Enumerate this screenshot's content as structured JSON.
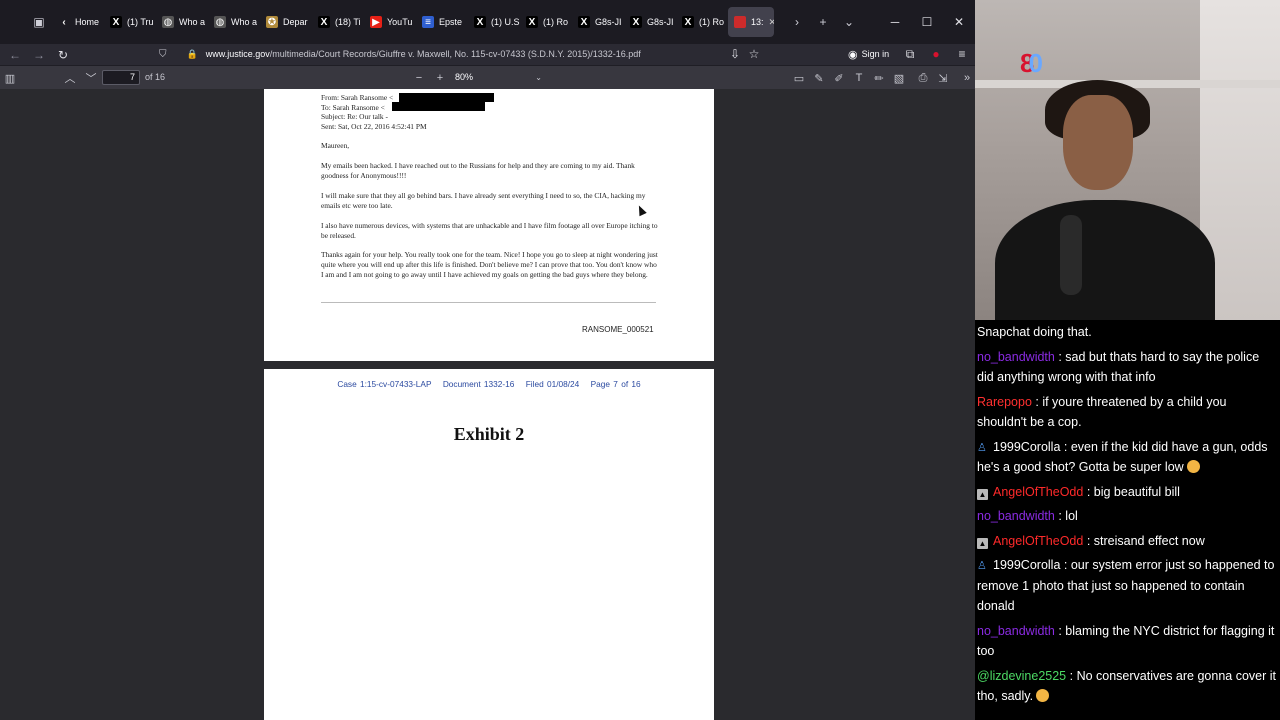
{
  "tabs": [
    {
      "label": "Home",
      "icon": "chevron-left-icon"
    },
    {
      "label": "(1) Tru",
      "icon": "x-logo-icon"
    },
    {
      "label": "Who a",
      "icon": "globe-icon"
    },
    {
      "label": "Who a",
      "icon": "globe-icon"
    },
    {
      "label": "Depar",
      "icon": "seal-icon"
    },
    {
      "label": "(18) Ti",
      "icon": "x-logo-icon"
    },
    {
      "label": "YouTu",
      "icon": "youtube-icon"
    },
    {
      "label": "Epste",
      "icon": "news-icon"
    },
    {
      "label": "(1) U.S",
      "icon": "x-logo-icon"
    },
    {
      "label": "(1) Ro",
      "icon": "x-logo-icon"
    },
    {
      "label": "G8s-JI",
      "icon": "x-logo-icon"
    },
    {
      "label": "G8s-JI",
      "icon": "x-logo-icon"
    },
    {
      "label": "(1) Ro",
      "icon": "x-logo-icon"
    },
    {
      "label": "13:",
      "icon": "pdf-icon",
      "active": true
    }
  ],
  "url": {
    "domain": "www.justice.gov",
    "path": "/multimedia/Court Records/Giuffre v. Maxwell, No. 115-cv-07433 (S.D.N.Y. 2015)/1332-16.pdf"
  },
  "signin_label": "Sign in",
  "pdf_toolbar": {
    "page_number": "7",
    "page_total": "of 16",
    "zoom": "80%"
  },
  "document": {
    "email_header": {
      "from": "From: Sarah Ransome <",
      "to": "To: Sarah Ransome <",
      "subject": "Subject: Re: Our talk -",
      "sent": "Sent: Sat, Oct 22, 2016 4:52:41 PM"
    },
    "greeting": "Maureen,",
    "paragraphs": [
      "My emails been hacked. I have reached out to the Russians for help and they are coming to my aid. Thank goodness for Anonymous!!!!",
      "I will make sure that they all go behind bars. I have already sent everything I need to so, the CIA, hacking my emails etc were too late.",
      "I also have numerous devices, with systems that are unhackable and I have film footage all over Europe itching to be released.",
      "Thanks again for your help. You really took one for the team. Nice! I hope you go to sleep at night wondering just quite where you will end up after this life is finished. Don't believe me? I can prove that too. You don't know who I am and I am not going to go away until I have achieved my goals on getting the bad guys where they belong."
    ],
    "bates": "RANSOME_000521",
    "page2_header": {
      "case": "Case 1:15-cv-07433-LAP",
      "document": "Document 1332-16",
      "filed": "Filed 01/08/24",
      "page": "Page 7 of 16"
    },
    "exhibit_title": "Exhibit 2"
  },
  "webcam": {
    "badge_primary": "8",
    "badge_secondary": "0"
  },
  "chat": [
    {
      "user": "",
      "user_color": "#ffffff",
      "text": "Snapchat doing that.",
      "badge": "none"
    },
    {
      "user": "no_bandwidth",
      "user_color": "#8a2be2",
      "text": ": sad but thats hard to say the police did anything wrong with that info",
      "badge": "none"
    },
    {
      "user": "Rarepopo",
      "user_color": "#ff3030",
      "text": ": if youre threatened by a child you shouldn't be a cop.",
      "badge": "none"
    },
    {
      "user": "1999Corolla",
      "user_color": "#ffffff",
      "text": ": even if the kid did have a gun, odds he's a good shot? Gotta be super low",
      "badge": "person",
      "emoji": true
    },
    {
      "user": "AngelOfTheOdd",
      "user_color": "#ff2a2a",
      "text": ": big beautiful bill",
      "badge": "square"
    },
    {
      "user": "no_bandwidth",
      "user_color": "#8a2be2",
      "text": ": lol",
      "badge": "none"
    },
    {
      "user": "AngelOfTheOdd",
      "user_color": "#ff2a2a",
      "text": ": streisand effect now",
      "badge": "square"
    },
    {
      "user": "1999Corolla",
      "user_color": "#ffffff",
      "text": ": our system error just so happened to remove 1 photo that just so happened to contain donald",
      "badge": "person"
    },
    {
      "user": "no_bandwidth",
      "user_color": "#8a2be2",
      "text": ": blaming the NYC district for flagging it too",
      "badge": "none"
    },
    {
      "user": "@lizdevine2525",
      "user_color": "#4cd964",
      "text": ": No conservatives are gonna cover it tho, sadly.",
      "badge": "none",
      "emoji": true
    }
  ],
  "colors": {
    "accent_red": "#d8122e",
    "link_blue": "#2b4aa0"
  }
}
